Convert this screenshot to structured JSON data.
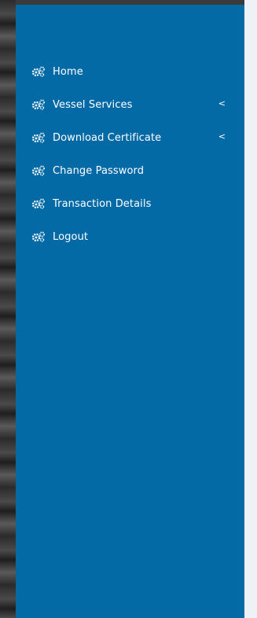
{
  "sidebar": {
    "items": [
      {
        "label": "Home",
        "icon": "gears-icon",
        "has_submenu": false
      },
      {
        "label": "Vessel Services",
        "icon": "gears-icon",
        "has_submenu": true,
        "caret": "<"
      },
      {
        "label": "Download Certificate",
        "icon": "gears-icon",
        "has_submenu": true,
        "caret": "<"
      },
      {
        "label": "Change Password",
        "icon": "gears-icon",
        "has_submenu": false
      },
      {
        "label": "Transaction Details",
        "icon": "gears-icon",
        "has_submenu": false
      },
      {
        "label": "Logout",
        "icon": "gears-icon",
        "has_submenu": false
      }
    ]
  },
  "colors": {
    "sidebar_bg": "#046aa6",
    "text": "#ffffff",
    "content_bg": "#eef1f5"
  }
}
